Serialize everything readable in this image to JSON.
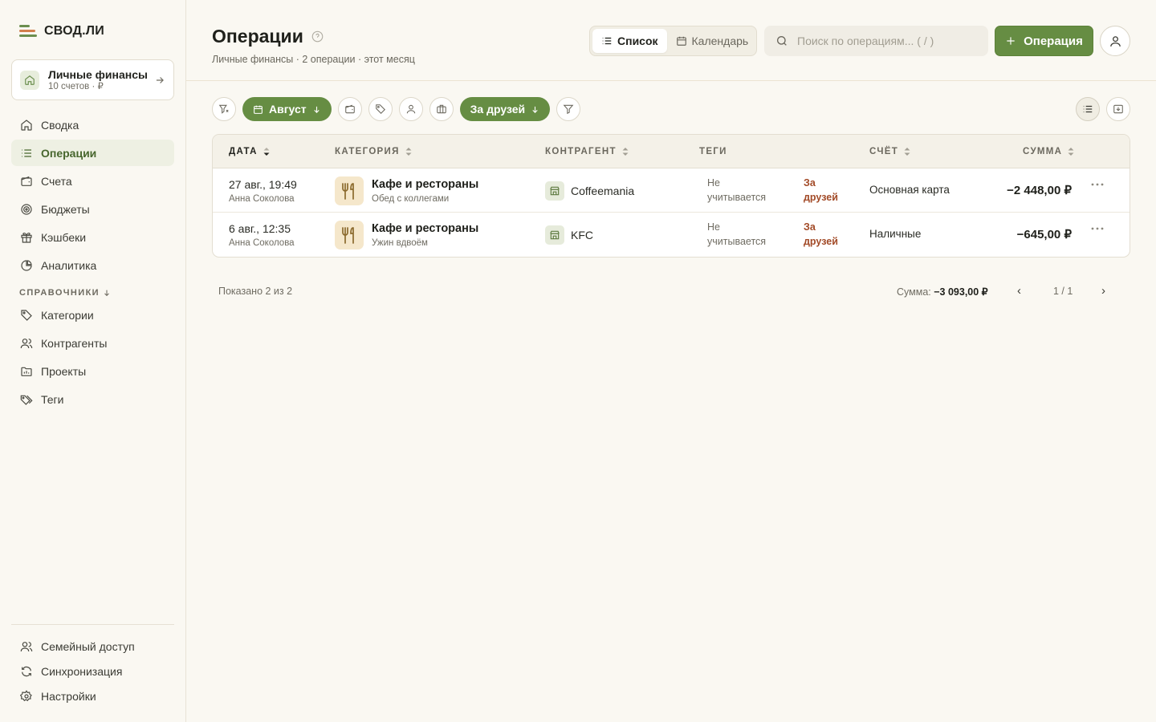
{
  "app": {
    "logo_text": "СВОД.ЛИ"
  },
  "workspace": {
    "name": "Личные финансы",
    "sub": "10 счетов · ₽"
  },
  "nav": [
    {
      "label": "Сводка",
      "icon": "home-icon"
    },
    {
      "label": "Операции",
      "icon": "list-icon",
      "active": true
    },
    {
      "label": "Счета",
      "icon": "wallet-icon"
    },
    {
      "label": "Бюджеты",
      "icon": "target-icon"
    },
    {
      "label": "Кэшбеки",
      "icon": "gift-icon"
    },
    {
      "label": "Аналитика",
      "icon": "pie-chart-icon"
    }
  ],
  "reference": {
    "label": "СПРАВОЧНИКИ",
    "items": [
      {
        "label": "Категории",
        "icon": "tag-icon"
      },
      {
        "label": "Контрагенты",
        "icon": "users-icon"
      },
      {
        "label": "Проекты",
        "icon": "folder-icon"
      },
      {
        "label": "Теги",
        "icon": "tags-icon"
      }
    ]
  },
  "bottom_nav": [
    {
      "label": "Семейный доступ",
      "icon": "family-icon"
    },
    {
      "label": "Синхронизация",
      "icon": "sync-icon"
    },
    {
      "label": "Настройки",
      "icon": "gear-icon"
    }
  ],
  "header": {
    "title": "Операции",
    "subtitle": "Личные финансы · 2 операции · этот месяц",
    "view_list": "Список",
    "view_calendar": "Календарь",
    "search_placeholder": "Поиск по операциям... ( / )",
    "add_label": "Операция"
  },
  "filters": {
    "month": "Август",
    "tag_filter": "За друзей"
  },
  "table": {
    "columns": {
      "date": "ДАТА",
      "category": "КАТЕГОРИЯ",
      "counterparty": "КОНТРАГЕНТ",
      "tags": "ТЕГИ",
      "account": "СЧЁТ",
      "amount": "СУММА"
    },
    "rows": [
      {
        "date": "27 авг., 19:49",
        "author": "Анна Соколова",
        "category": "Кафе и рестораны",
        "note": "Обед с коллегами",
        "counterparty": "Coffeemania",
        "tag_status": "Не учитывается",
        "tag": "За друзей",
        "account": "Основная карта",
        "amount": "−2 448,00 ₽"
      },
      {
        "date": "6 авг., 12:35",
        "author": "Анна Соколова",
        "category": "Кафе и рестораны",
        "note": "Ужин вдвоём",
        "counterparty": "KFC",
        "tag_status": "Не учитывается",
        "tag": "За друзей",
        "account": "Наличные",
        "amount": "−645,00 ₽"
      }
    ]
  },
  "footer": {
    "shown": "Показано 2 из 2",
    "sum_label": "Сумма:",
    "sum_value": "−3 093,00 ₽",
    "page": "1 / 1",
    "prev": "‹",
    "next": "›"
  },
  "colors": {
    "accent": "#668d43",
    "accent_dark": "#47662d",
    "tag_text": "#a24a27",
    "background": "#faf8f2"
  }
}
